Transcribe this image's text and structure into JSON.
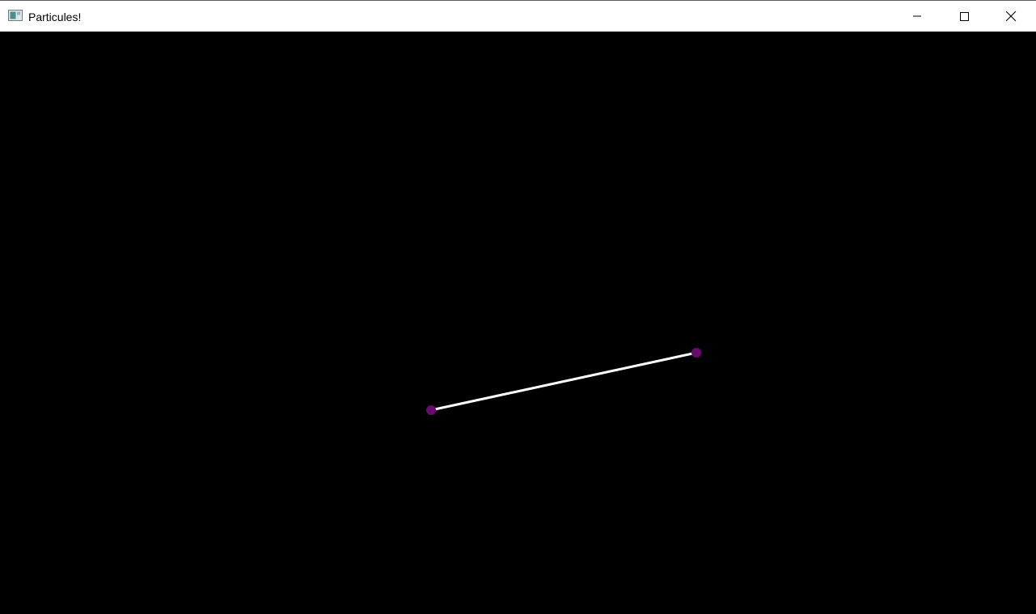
{
  "window": {
    "title": "Particules!",
    "icon": "app-window-icon",
    "controls": {
      "minimize_icon": "minimize-icon",
      "maximize_icon": "maximize-icon",
      "close_icon": "close-icon"
    }
  },
  "scene": {
    "background_color": "#000000",
    "particle_color": "#6a0a6e",
    "link_color": "#ffffff",
    "particle_count": 2,
    "link_count": 1
  }
}
